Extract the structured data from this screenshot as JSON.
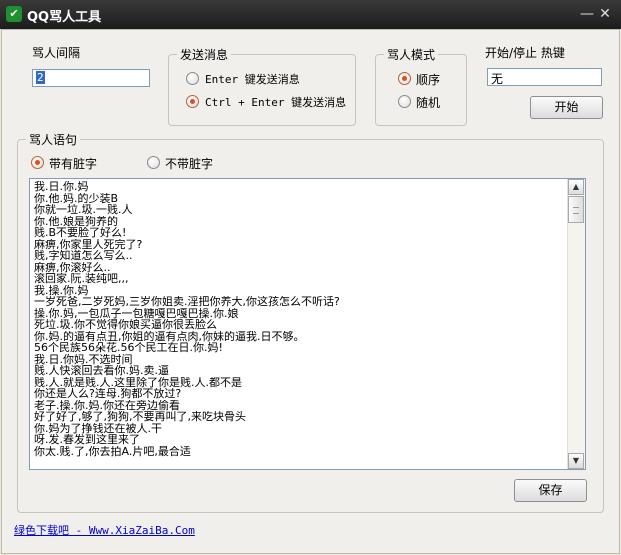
{
  "window": {
    "title": "QQ骂人工具",
    "minimize_glyph": "—",
    "close_glyph": "✕"
  },
  "interval": {
    "label": "骂人间隔",
    "value": "2"
  },
  "send": {
    "group_title": "发送消息",
    "option_enter": "Enter 键发送消息",
    "option_ctrl_enter": "Ctrl + Enter 键发送消息",
    "selected": "ctrl_enter"
  },
  "mode": {
    "group_title": "骂人模式",
    "option_sequential": "顺序",
    "option_random": "随机",
    "selected": "sequential"
  },
  "hotkey": {
    "label": "开始/停止 热键",
    "value": "无",
    "start_button": "开始"
  },
  "phrases": {
    "group_title": "骂人语句",
    "option_dirty": "带有脏字",
    "option_clean": "不带脏字",
    "selected": "dirty",
    "lines": [
      "我.日.你.妈",
      "你.他.妈.的少装B",
      "你就一垃.圾.一贱.人",
      "你.他.娘是狗养的",
      "贱.B不要脸了好么!",
      "麻痹,你家里人死完了?",
      "贱,字知道怎么写么..",
      "麻痹,你滚好么..",
      "滚回家.阮.装纯吧,,,",
      "我.操.你.妈",
      "一岁死爸,二岁死妈,三岁你姐卖.淫把你养大,你这孩怎么不听话?",
      "操.你.妈,一包瓜子一包糖嘎巴嘎巴操.你.娘",
      "死垃.圾.你不觉得你娘买逼你很丢脸么",
      "你.妈.的逼有点丑,你姐的逼有点肉,你妹的逼我.日不够。",
      "56个民族56朵花.56个民工在日.你.妈!",
      "我.日.你妈.不选时间",
      "贱.人快滚回去看你.妈.卖.逼",
      "贱.人.就是贱.人.这里除了你是贱.人.都不是",
      "你还是人么?连母.狗都不放过?",
      "老子.操.你.妈.你还在旁边偷看",
      "好了好了,够了,狗狗,不要再叫了,来吃块骨头",
      "你.妈为了挣钱还在被人.干",
      "呀.发.春发到这里来了",
      "你太.贱.了,你去拍A.片吧,最合适"
    ]
  },
  "save_button": "保存",
  "footer_link": "绿色下载吧 - Www.XiaZaiBa.Com"
}
